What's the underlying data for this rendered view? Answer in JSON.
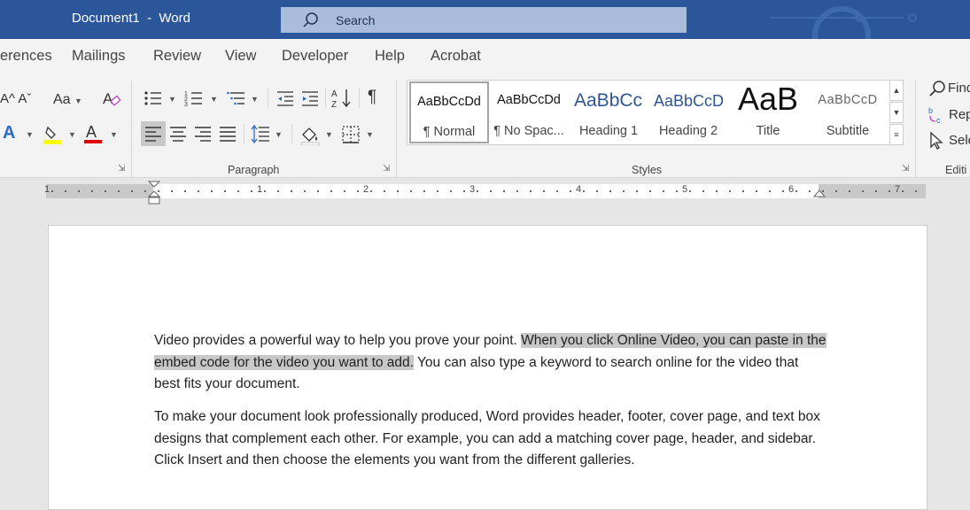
{
  "window": {
    "doc_name": "Document1",
    "separator": "-",
    "app_name": "Word",
    "search_placeholder": "Search"
  },
  "tabs": [
    "erences",
    "Mailings",
    "Review",
    "View",
    "Developer",
    "Help",
    "Acrobat"
  ],
  "ribbon": {
    "groups": {
      "paragraph": "Paragraph",
      "styles": "Styles",
      "editing": "Editi"
    },
    "font_group": {
      "grow_shrink": "A^ Aˇ",
      "change_case": "Aa",
      "text_effects": "A",
      "font_color": "A"
    },
    "editing_items": [
      "Find",
      "Rep",
      "Sele"
    ],
    "colors": {
      "highlight": "#ffff00",
      "font_color": "#e00000",
      "text_effect": "#2b6cc4"
    }
  },
  "styles": [
    {
      "preview": "AaBbCcDd",
      "name": "¶ Normal"
    },
    {
      "preview": "AaBbCcDd",
      "name": "¶ No Spac..."
    },
    {
      "preview": "AaBbCc",
      "name": "Heading 1"
    },
    {
      "preview": "AaBbCcD",
      "name": "Heading 2"
    },
    {
      "preview": "AaB",
      "name": "Title"
    },
    {
      "preview": "AaBbCcD",
      "name": "Subtitle"
    }
  ],
  "ruler": {
    "numbers": [
      "1",
      "1",
      "2",
      "3",
      "4",
      "5",
      "6",
      "7"
    ]
  },
  "document": {
    "p1_a": "Video provides a powerful way to help you prove your point. ",
    "p1_hl": "When you click Online Video, you can paste in the embed code for the video you want to add.",
    "p1_b": " You can also type a keyword to search online for the video that best fits your document.",
    "p2": "To make your document look professionally produced, Word provides header, footer, cover page, and text box designs that complement each other. For example, you can add a matching cover page, header, and sidebar. Click Insert and then choose the elements you want from the different galleries."
  }
}
